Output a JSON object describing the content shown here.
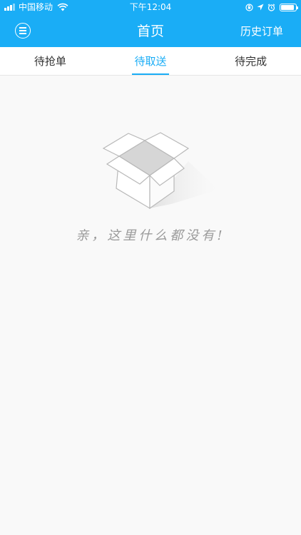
{
  "status_bar": {
    "carrier": "中国移动",
    "time": "下午12:04"
  },
  "header": {
    "title": "首页",
    "history_label": "历史订单"
  },
  "tabs": [
    {
      "label": "待抢单",
      "active": false
    },
    {
      "label": "待取送",
      "active": true
    },
    {
      "label": "待完成",
      "active": false
    }
  ],
  "empty_state": {
    "icon": "open-box-icon",
    "message": "亲，这里什么都没有!"
  },
  "colors": {
    "primary": "#1aadf6",
    "background": "#f9f9f9"
  }
}
